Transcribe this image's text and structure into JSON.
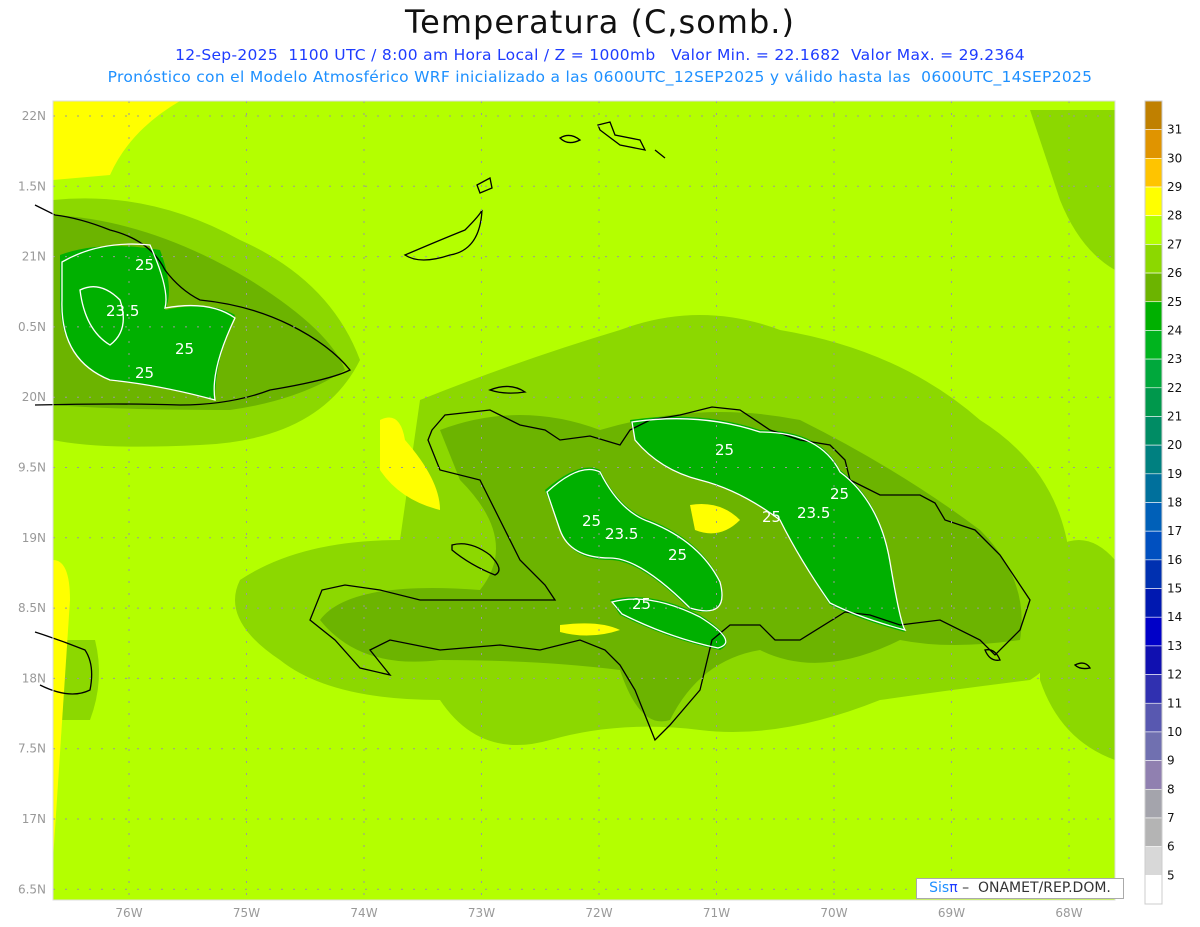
{
  "header": {
    "title": "Temperatura (C,somb.)",
    "subtitle1": "12-Sep-2025  1100 UTC / 8:00 am Hora Local / Z = 1000mb   Valor Min. = 22.1682  Valor Max. = 29.2364",
    "subtitle2": "Pronóstico con el Modelo Atmosférico WRF inicializado a las 0600UTC_12SEP2025 y válido hasta las  0600UTC_14SEP2025"
  },
  "axes": {
    "lat_labels": [
      "22N",
      "1.5N",
      "21N",
      "0.5N",
      "20N",
      "9.5N",
      "19N",
      "8.5N",
      "18N",
      "7.5N",
      "17N",
      "6.5N"
    ],
    "lon_labels": [
      "76W",
      "75W",
      "74W",
      "73W",
      "72W",
      "71W",
      "70W",
      "69W",
      "68W"
    ]
  },
  "colorbar": {
    "labels": [
      "31",
      "30",
      "29",
      "28",
      "27",
      "26",
      "25",
      "24",
      "23",
      "22",
      "21",
      "20",
      "19",
      "18",
      "17",
      "16",
      "15",
      "14",
      "13",
      "12",
      "11",
      "10",
      "9",
      "8",
      "7",
      "6",
      "5"
    ],
    "colors": [
      "#c08000",
      "#e09400",
      "#ffc400",
      "#ffff00",
      "#b4ff00",
      "#8cd800",
      "#6cb400",
      "#00b000",
      "#00b41e",
      "#00a83c",
      "#00984c",
      "#008c64",
      "#008080",
      "#00709c",
      "#0060b8",
      "#0050c0",
      "#0030b0",
      "#0018b0",
      "#0000c8",
      "#1010b0",
      "#3030b0",
      "#5858b0",
      "#7070b0",
      "#9080b0",
      "#a4a4ac",
      "#b4b4b4",
      "#d8d8d8",
      "#ffffff"
    ]
  },
  "contour_labels": [
    "25",
    "25",
    "25",
    "23.5",
    "25",
    "25",
    "25",
    "23.5",
    "25",
    "23.5",
    "25",
    "25"
  ],
  "credit": {
    "brand": "Sis",
    "brand_symbol": "π",
    "text": " –  ONAMET/REP.DOM."
  }
}
